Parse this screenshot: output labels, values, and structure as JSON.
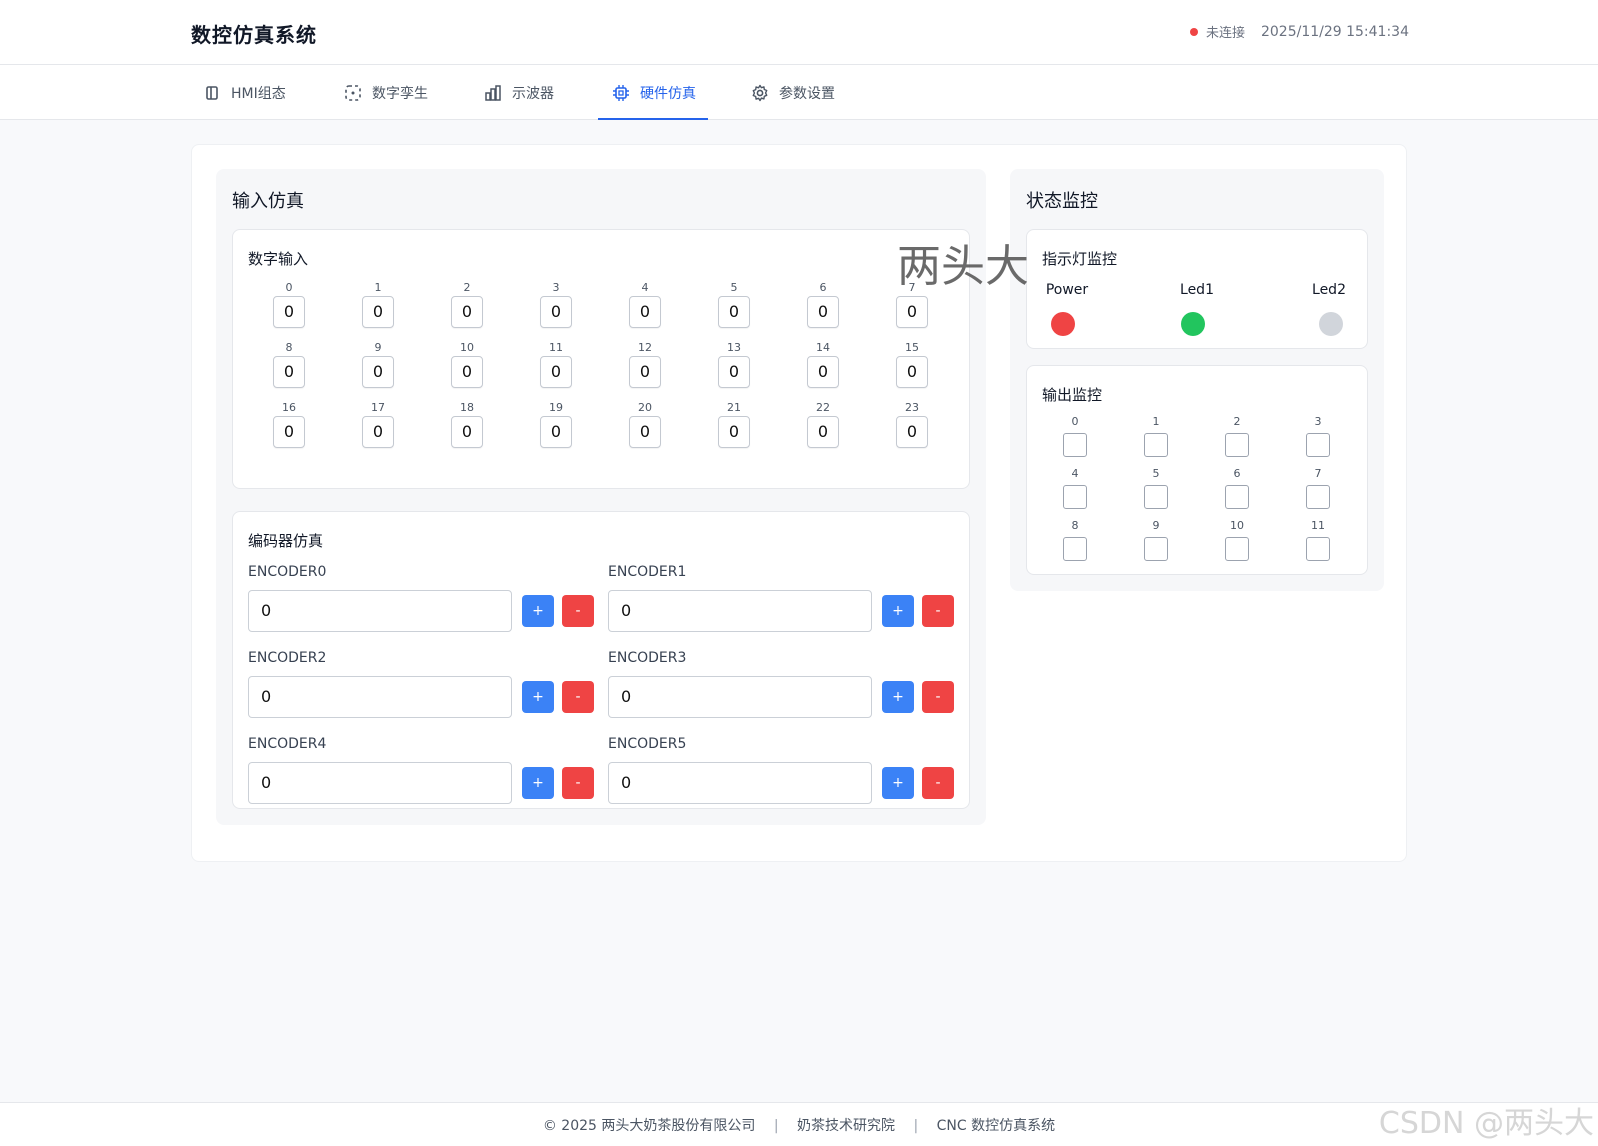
{
  "header": {
    "app_title": "数控仿真系统",
    "connection_status": "未连接",
    "datetime": "2025/11/29 15:41:34",
    "status_color": "#ef4444"
  },
  "tabs": [
    {
      "label": "HMI组态",
      "icon": "panel-icon"
    },
    {
      "label": "数字孪生",
      "icon": "dashed-frame-icon"
    },
    {
      "label": "示波器",
      "icon": "bar-chart-icon"
    },
    {
      "label": "硬件仿真",
      "icon": "chip-icon",
      "active": true
    },
    {
      "label": "参数设置",
      "icon": "gear-icon"
    }
  ],
  "input_panel": {
    "title": "输入仿真",
    "digital_input": {
      "title": "数字输入",
      "channels": [
        {
          "label": "0",
          "value": "0"
        },
        {
          "label": "1",
          "value": "0"
        },
        {
          "label": "2",
          "value": "0"
        },
        {
          "label": "3",
          "value": "0"
        },
        {
          "label": "4",
          "value": "0"
        },
        {
          "label": "5",
          "value": "0"
        },
        {
          "label": "6",
          "value": "0"
        },
        {
          "label": "7",
          "value": "0"
        },
        {
          "label": "8",
          "value": "0"
        },
        {
          "label": "9",
          "value": "0"
        },
        {
          "label": "10",
          "value": "0"
        },
        {
          "label": "11",
          "value": "0"
        },
        {
          "label": "12",
          "value": "0"
        },
        {
          "label": "13",
          "value": "0"
        },
        {
          "label": "14",
          "value": "0"
        },
        {
          "label": "15",
          "value": "0"
        },
        {
          "label": "16",
          "value": "0"
        },
        {
          "label": "17",
          "value": "0"
        },
        {
          "label": "18",
          "value": "0"
        },
        {
          "label": "19",
          "value": "0"
        },
        {
          "label": "20",
          "value": "0"
        },
        {
          "label": "21",
          "value": "0"
        },
        {
          "label": "22",
          "value": "0"
        },
        {
          "label": "23",
          "value": "0"
        }
      ]
    },
    "encoder": {
      "title": "编码器仿真",
      "plus_label": "+",
      "minus_label": "-",
      "items": [
        {
          "label": "ENCODER0",
          "value": "0"
        },
        {
          "label": "ENCODER1",
          "value": "0"
        },
        {
          "label": "ENCODER2",
          "value": "0"
        },
        {
          "label": "ENCODER3",
          "value": "0"
        },
        {
          "label": "ENCODER4",
          "value": "0"
        },
        {
          "label": "ENCODER5",
          "value": "0"
        }
      ]
    }
  },
  "status_panel": {
    "title": "状态监控",
    "leds": {
      "title": "指示灯监控",
      "items": [
        {
          "label": "Power",
          "color": "#ef4444"
        },
        {
          "label": "Led1",
          "color": "#22c55e"
        },
        {
          "label": "Led2",
          "color": "#d1d5db"
        }
      ]
    },
    "outputs": {
      "title": "输出监控",
      "channels": [
        {
          "label": "0",
          "on": false
        },
        {
          "label": "1",
          "on": false
        },
        {
          "label": "2",
          "on": false
        },
        {
          "label": "3",
          "on": false
        },
        {
          "label": "4",
          "on": false
        },
        {
          "label": "5",
          "on": false
        },
        {
          "label": "6",
          "on": false
        },
        {
          "label": "7",
          "on": false
        },
        {
          "label": "8",
          "on": false
        },
        {
          "label": "9",
          "on": false
        },
        {
          "label": "10",
          "on": false
        },
        {
          "label": "11",
          "on": false
        }
      ]
    }
  },
  "watermark": "两头大",
  "footer": {
    "copyright": "© 2025 两头大奶茶股份有限公司",
    "institute": "奶茶技术研究院",
    "system": "CNC 数控仿真系统",
    "separator": "|"
  },
  "csdn_watermark": "CSDN @两头大"
}
